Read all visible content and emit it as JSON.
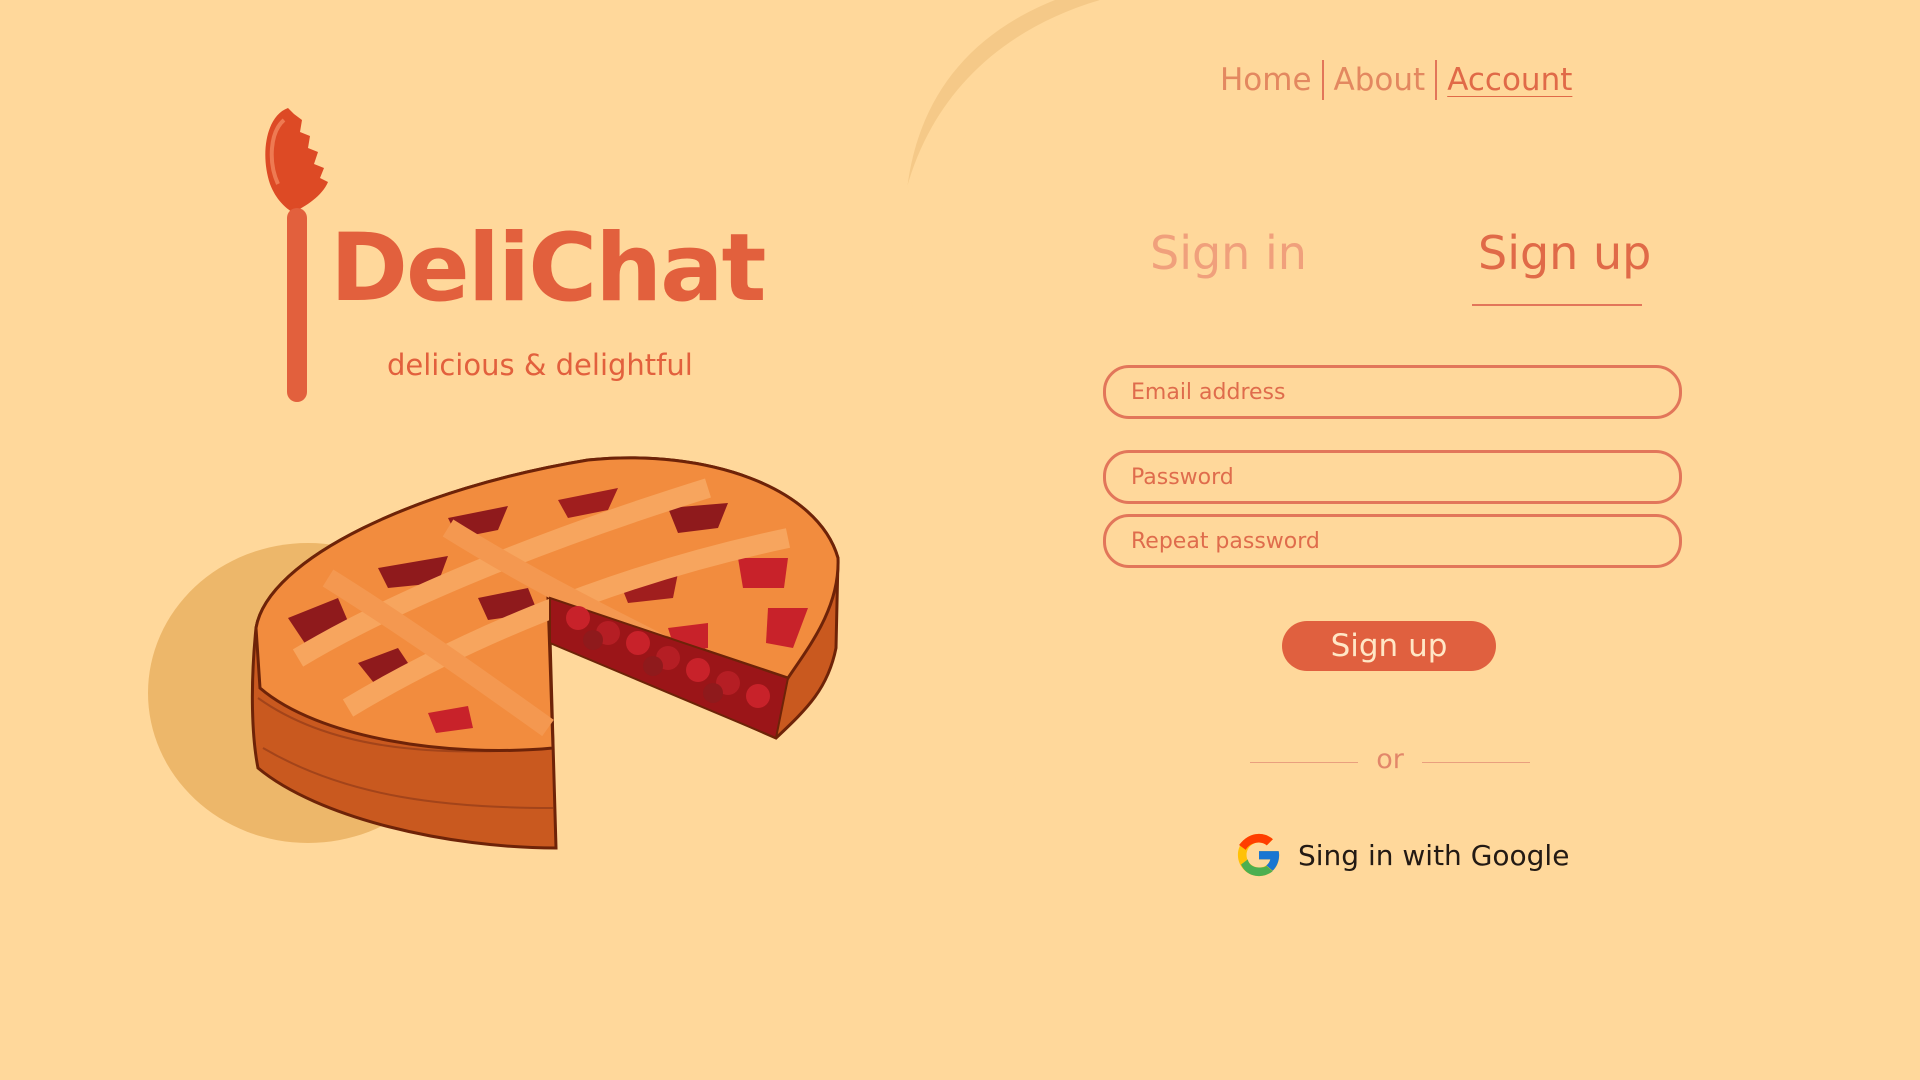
{
  "nav": {
    "items": [
      {
        "label": "Home"
      },
      {
        "label": "About"
      },
      {
        "label": "Account"
      }
    ],
    "active": "Account"
  },
  "brand": {
    "name": "DeliChat",
    "tagline": "delicious & delightful"
  },
  "auth": {
    "tabs": [
      {
        "label": "Sign in"
      },
      {
        "label": "Sign up"
      }
    ],
    "active_tab": "Sign up",
    "fields": {
      "email": {
        "placeholder": "Email address",
        "value": ""
      },
      "password": {
        "placeholder": "Password",
        "value": ""
      },
      "repeat_password": {
        "placeholder": "Repeat password",
        "value": ""
      }
    },
    "submit_label": "Sign up",
    "divider_text": "or",
    "google_label": "Sing in with Google"
  },
  "icons": {
    "logo": "spoon-icon",
    "google": "google-icon"
  },
  "colors": {
    "background": "#FFD89B",
    "accent": "#E0603F",
    "wave": "#F6C98A"
  }
}
